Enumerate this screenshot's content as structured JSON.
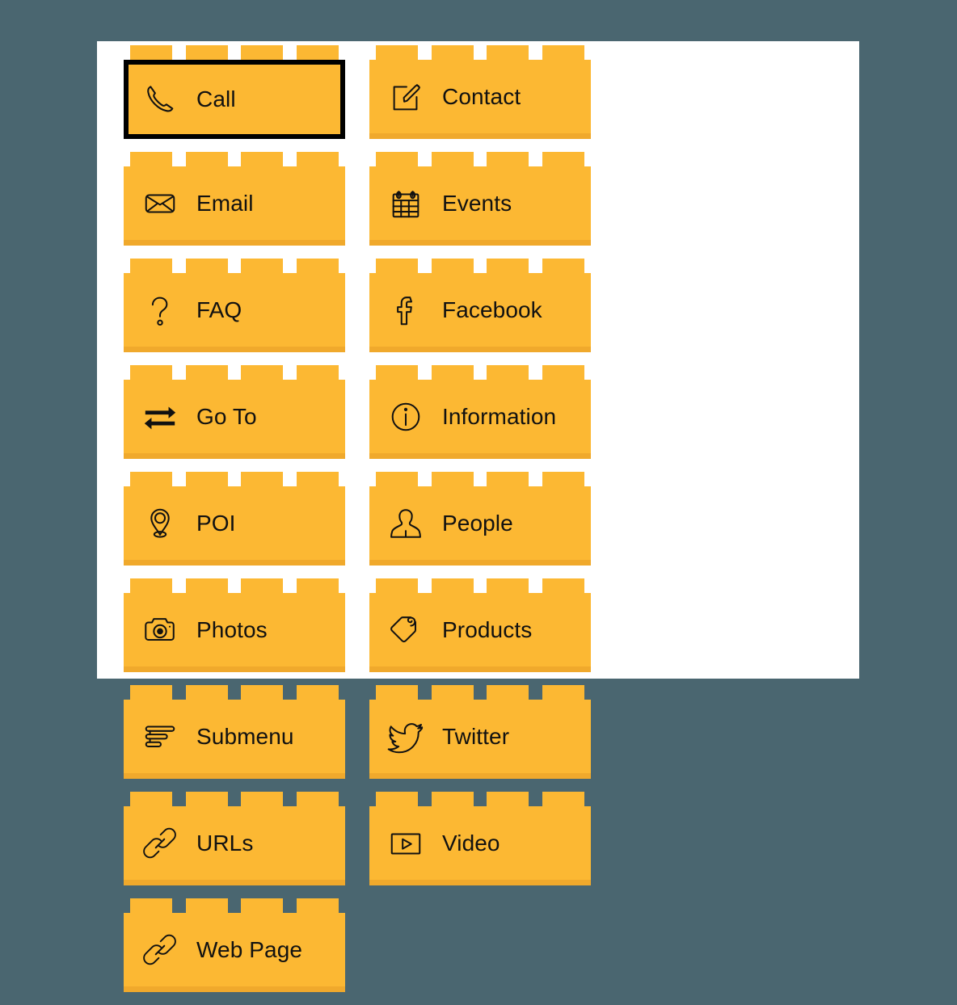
{
  "page": {
    "background_color": "#4a6670",
    "panel_color": "#ffffff",
    "brick_color": "#fcb833",
    "brick_shadow_color": "#f0a92c",
    "label_color": "#111111",
    "selected_outline_color": "#000000"
  },
  "bricks": [
    {
      "id": "call",
      "label": "Call",
      "icon": "phone-icon",
      "selected": true
    },
    {
      "id": "contact",
      "label": "Contact",
      "icon": "compose-icon",
      "selected": false
    },
    {
      "id": "email",
      "label": "Email",
      "icon": "envelope-icon",
      "selected": false
    },
    {
      "id": "events",
      "label": "Events",
      "icon": "calendar-icon",
      "selected": false
    },
    {
      "id": "faq",
      "label": "FAQ",
      "icon": "question-icon",
      "selected": false
    },
    {
      "id": "facebook",
      "label": "Facebook",
      "icon": "facebook-icon",
      "selected": false
    },
    {
      "id": "goto",
      "label": "Go To",
      "icon": "arrows-icon",
      "selected": false
    },
    {
      "id": "information",
      "label": "Information",
      "icon": "info-circle-icon",
      "selected": false
    },
    {
      "id": "poi",
      "label": "POI",
      "icon": "map-pin-icon",
      "selected": false
    },
    {
      "id": "people",
      "label": "People",
      "icon": "person-icon",
      "selected": false
    },
    {
      "id": "photos",
      "label": "Photos",
      "icon": "camera-icon",
      "selected": false
    },
    {
      "id": "products",
      "label": "Products",
      "icon": "tag-icon",
      "selected": false
    },
    {
      "id": "submenu",
      "label": "Submenu",
      "icon": "list-bars-icon",
      "selected": false
    },
    {
      "id": "twitter",
      "label": "Twitter",
      "icon": "twitter-icon",
      "selected": false
    },
    {
      "id": "urls",
      "label": "URLs",
      "icon": "link-icon",
      "selected": false
    },
    {
      "id": "video",
      "label": "Video",
      "icon": "play-box-icon",
      "selected": false
    },
    {
      "id": "webpage",
      "label": "Web Page",
      "icon": "link-icon",
      "selected": false
    }
  ]
}
